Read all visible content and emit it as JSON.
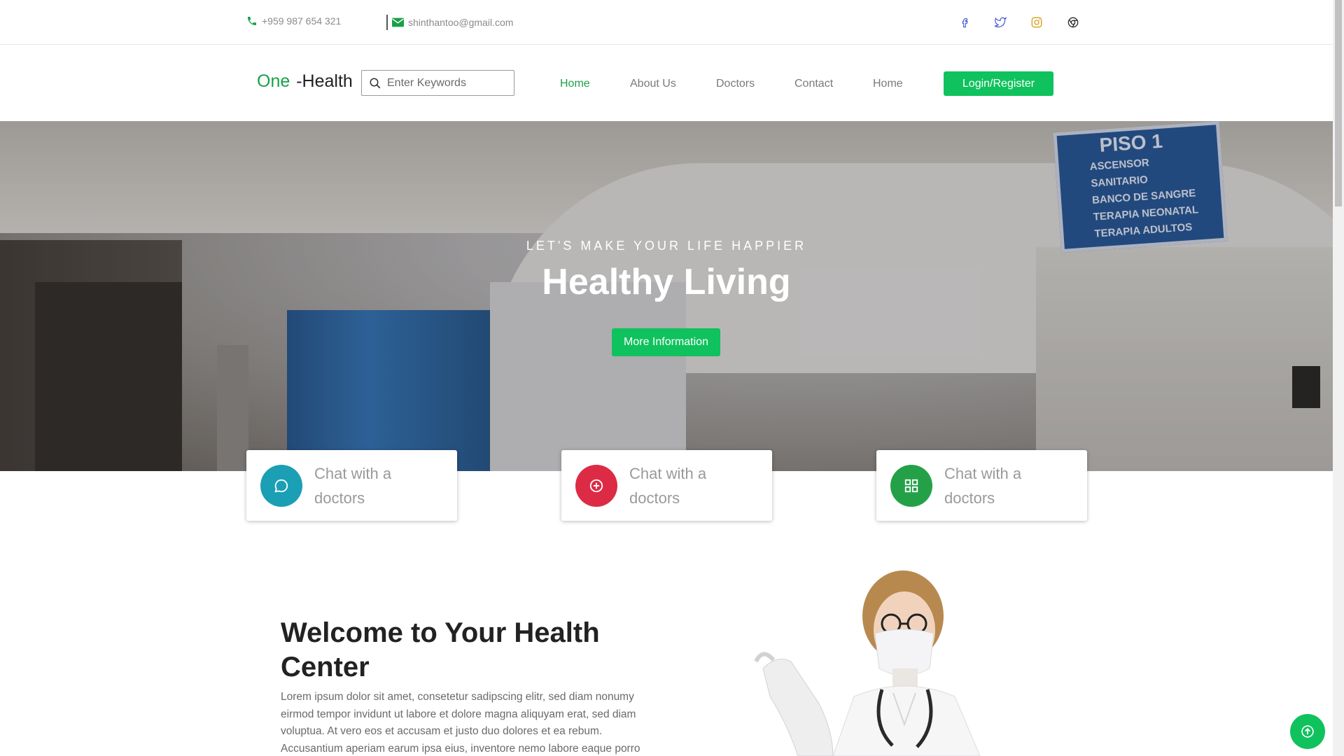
{
  "topbar": {
    "phone": "+959 987 654 321",
    "email": "shinthantoo@gmail.com",
    "social": [
      {
        "icon": "facebook-icon",
        "color": "#3b4fd8"
      },
      {
        "icon": "twitter-icon",
        "color": "#3b4fd8"
      },
      {
        "icon": "instagram-icon",
        "color": "#d4a017"
      },
      {
        "icon": "chrome-icon",
        "color": "#2b2b2b"
      }
    ]
  },
  "nav": {
    "logo_accent": "One",
    "logo_rest": "-Health",
    "search_placeholder": "Enter Keywords",
    "links": [
      "Home",
      "About Us",
      "Doctors",
      "Contact",
      "Home"
    ],
    "login_label": "Login/Register"
  },
  "hero": {
    "subtitle": "LET'S MAKE YOUR LIFE HAPPIER",
    "title": "Healthy Living",
    "button": "More Information",
    "sign_lines": [
      "PISO 1",
      "ASCENSOR",
      "SANITARIO",
      "BANCO DE SANGRE",
      "TERAPIA NEONATAL",
      "TERAPIA ADULTOS"
    ]
  },
  "cards": [
    {
      "label": "Chat with a doctors",
      "icon": "chat-icon",
      "color": "#1a9fb5"
    },
    {
      "label": "Chat with a doctors",
      "icon": "plus-circle-icon",
      "color": "#dd2b45"
    },
    {
      "label": "Chat with a doctors",
      "icon": "grid-icon",
      "color": "#24a148"
    }
  ],
  "welcome": {
    "title": "Welcome to Your Health Center",
    "text": "Lorem ipsum dolor sit amet, consetetur sadipscing elitr, sed diam nonumy eirmod tempor invidunt ut labore et dolore magna aliquyam erat, sed diam voluptua. At vero eos et accusam et justo duo dolores et ea rebum. Accusantium aperiam earum ipsa eius, inventore nemo labore eaque porro"
  },
  "colors": {
    "brand_green": "#0fc25d",
    "logo_green": "#1aa049"
  }
}
